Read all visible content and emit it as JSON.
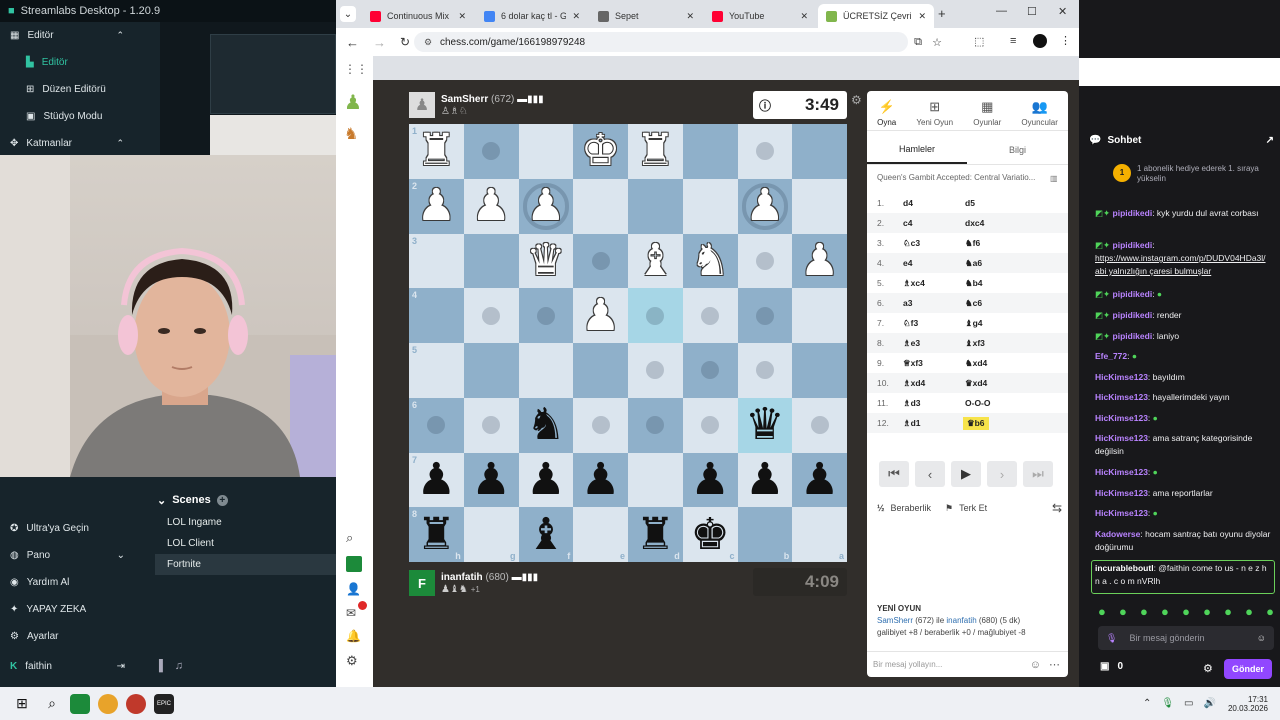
{
  "streamlabs": {
    "title": "Streamlabs Desktop - 1.20.9",
    "nav": [
      {
        "label": "Editör",
        "icon": "layout-icon",
        "chevron": "⌃"
      },
      {
        "label": "Editör",
        "icon": "editor-icon",
        "active": true
      },
      {
        "label": "Düzen Editörü",
        "icon": "grid-icon"
      },
      {
        "label": "Stüdyo Modu",
        "icon": "studio-icon"
      },
      {
        "label": "Katmanlar",
        "icon": "layers-icon",
        "chevron": "⌃"
      }
    ],
    "scenes_title": "Scenes",
    "scenes": [
      "LOL Ingame",
      "LOL Client",
      "Fortnite"
    ],
    "bottom_nav": [
      {
        "label": "Ultra'ya Geçin",
        "icon": "ultra-icon"
      },
      {
        "label": "Pano",
        "icon": "dashboard-icon",
        "chevron": "⌄"
      },
      {
        "label": "Yardım Al",
        "icon": "help-icon"
      },
      {
        "label": "YAPAY ZEKA",
        "icon": "ai-icon"
      },
      {
        "label": "Ayarlar",
        "icon": "settings-icon"
      },
      {
        "label": "faithin",
        "icon": "user-icon"
      }
    ]
  },
  "browser": {
    "tabs": [
      {
        "label": "Continuous Mix 1",
        "color": "#ff0033"
      },
      {
        "label": "6 dolar kaç tl - Goo",
        "color": "#4285f4"
      },
      {
        "label": "Sepet",
        "color": "#666666"
      },
      {
        "label": "YouTube",
        "color": "#ff0033"
      },
      {
        "label": "ÜCRETSİZ Çevrimi",
        "color": "#81b64c",
        "active": true
      }
    ],
    "url": "chess.com/game/166198979248"
  },
  "chess": {
    "top_player": {
      "name": "SamSherr",
      "rating": "(672)",
      "clock": "3:49"
    },
    "bottom_player": {
      "name": "inanfatih",
      "rating": "(680)",
      "clock": "4:09",
      "extra": "+1"
    },
    "board": [
      [
        "wR",
        "",
        "",
        "wK",
        "wR",
        "",
        "",
        ""
      ],
      [
        "wP",
        "wP",
        "wP",
        "",
        "",
        "",
        "wP",
        ""
      ],
      [
        "",
        "",
        "wQ",
        "",
        "wB",
        "wN",
        "",
        "wP"
      ],
      [
        "",
        "",
        "",
        "wP",
        "",
        "",
        "",
        ""
      ],
      [
        "",
        "",
        "",
        "",
        "",
        "",
        "",
        ""
      ],
      [
        "",
        "",
        "bN",
        "",
        "",
        "",
        "bQ",
        ""
      ],
      [
        "bP",
        "bP",
        "bP",
        "bP",
        "",
        "bP",
        "bP",
        "bP"
      ],
      [
        "bR",
        "",
        "bB",
        "",
        "bR",
        "bK",
        "",
        ""
      ]
    ],
    "rank_labels": [
      "1",
      "2",
      "3",
      "4",
      "5",
      "6",
      "7",
      "8"
    ],
    "file_labels": [
      "h",
      "g",
      "f",
      "e",
      "d",
      "c",
      "b",
      "a"
    ],
    "panel_tabs": [
      "Oyna",
      "Yeni Oyun",
      "Oyunlar",
      "Oyuncular"
    ],
    "subtabs": [
      "Hamleler",
      "Bilgi"
    ],
    "opening": "Queen's Gambit Accepted: Central Variatio...",
    "moves": [
      {
        "n": "1.",
        "w": "d4",
        "b": "d5"
      },
      {
        "n": "2.",
        "w": "c4",
        "b": "dxc4"
      },
      {
        "n": "3.",
        "w": "♘c3",
        "b": "♞f6"
      },
      {
        "n": "4.",
        "w": "e4",
        "b": "♞a6"
      },
      {
        "n": "5.",
        "w": "♗xc4",
        "b": "♞b4"
      },
      {
        "n": "6.",
        "w": "a3",
        "b": "♞c6"
      },
      {
        "n": "7.",
        "w": "♘f3",
        "b": "♝g4"
      },
      {
        "n": "8.",
        "w": "♗e3",
        "b": "♝xf3"
      },
      {
        "n": "9.",
        "w": "♕xf3",
        "b": "♞xd4"
      },
      {
        "n": "10.",
        "w": "♗xd4",
        "b": "♛xd4"
      },
      {
        "n": "11.",
        "w": "♗d3",
        "b": "O-O-O"
      },
      {
        "n": "12.",
        "w": "♗d1",
        "b": "♛b6"
      }
    ],
    "draw_label": "Beraberlik",
    "resign_label": "Terk Et",
    "new_game_title": "YENİ OYUN",
    "new_game_line1_a": "SamSherr",
    "new_game_line1_b": "(672) ile",
    "new_game_line1_c": "inanfatih",
    "new_game_line1_d": "(680) (5 dk)",
    "new_game_line2": "galibiyet +8 / beraberlik +0 / mağlubiyet -8",
    "chat_placeholder": "Bir mesaj yollayın..."
  },
  "twitch": {
    "chat_title": "Sohbet",
    "pinned": "1 abonelik hediye ederek 1. sıraya yükselin",
    "messages": [
      {
        "user": "pipidikedi",
        "color": "#b983ff",
        "text": "kyk yurdu dul avrat corbası"
      },
      {
        "user": "pipidikedi",
        "color": "#b983ff",
        "text": "https://www.instagram.com/p/DUDV04HDa3l/ abi yalnızlığın çaresi bulmuşlar"
      },
      {
        "user": "pipidikedi",
        "color": "#b983ff",
        "text": ""
      },
      {
        "user": "pipidikedi",
        "color": "#b983ff",
        "text": "render"
      },
      {
        "user": "pipidikedi",
        "color": "#b983ff",
        "text": "laniyo"
      },
      {
        "user": "Efe_772",
        "color": "#b983ff",
        "text": ""
      },
      {
        "user": "HicKimse123",
        "color": "#b983ff",
        "text": "bayıldım"
      },
      {
        "user": "HicKimse123",
        "color": "#b983ff",
        "text": "hayallerimdeki yayın"
      },
      {
        "user": "HicKimse123",
        "color": "#b983ff",
        "text": ""
      },
      {
        "user": "HicKimse123",
        "color": "#b983ff",
        "text": "ama satranç kategorisinde değilsin"
      },
      {
        "user": "HicKimse123",
        "color": "#b983ff",
        "text": ""
      },
      {
        "user": "HicKimse123",
        "color": "#b983ff",
        "text": "ama reportlarlar"
      },
      {
        "user": "HicKimse123",
        "color": "#b983ff",
        "text": ""
      },
      {
        "user": "Kadowerse",
        "color": "#b983ff",
        "text": "hocam santraç batı oyunu diyolar doğürumu"
      },
      {
        "user": "incurableboutl",
        "color": "#ffffff",
        "text": "@faithin come to us - n e z h n a . c o m nVRlh"
      }
    ],
    "input_placeholder": "Bir mesaj gönderin",
    "points": "0",
    "send": "Gönder"
  },
  "taskbar": {
    "time": "17:31",
    "date": "20.03.2026"
  }
}
